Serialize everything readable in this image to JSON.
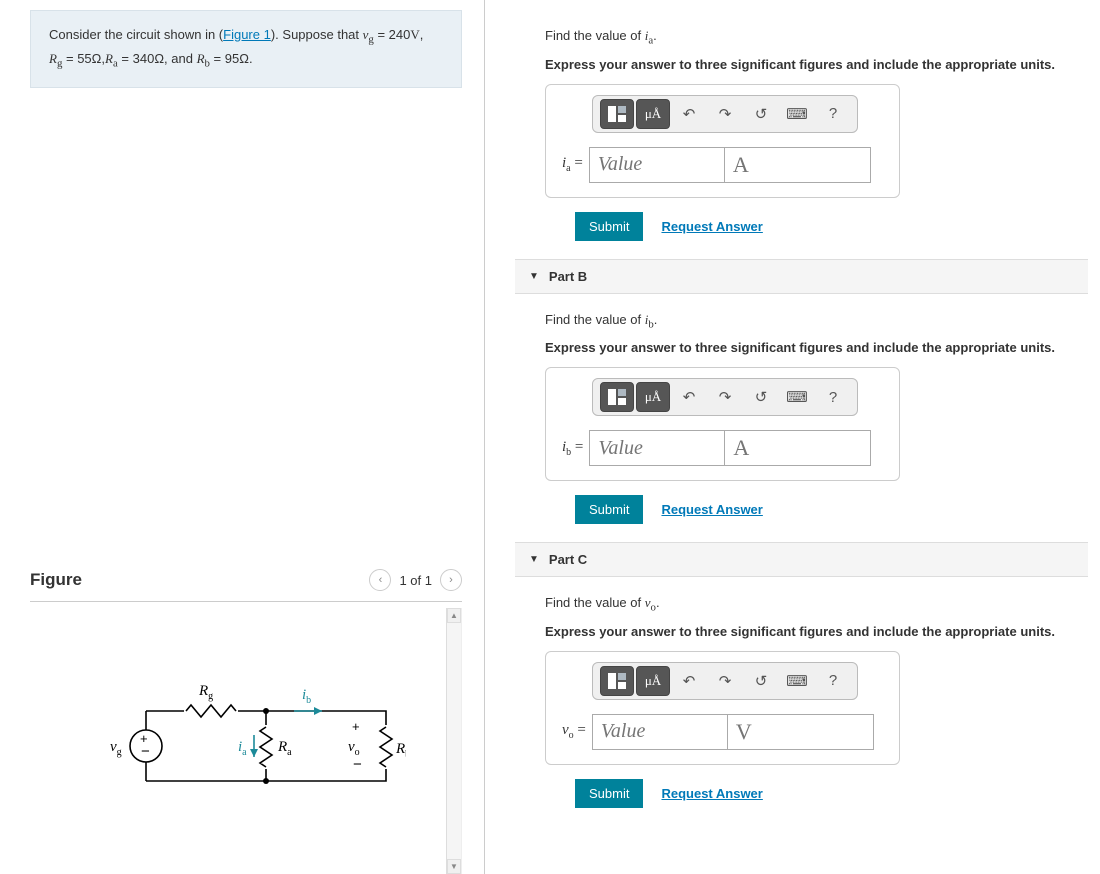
{
  "problem": {
    "pre": "Consider the circuit shown in (",
    "figlink": "Figure 1",
    "post": "). Suppose that ",
    "vg_val": "240",
    "rg_val": "55",
    "ra_val": "340",
    "rb_val": "95"
  },
  "figure": {
    "title": "Figure",
    "pager": "1 of 1",
    "labels": {
      "rg": "R",
      "ib": "i",
      "vg": "v",
      "ia": "i",
      "ra": "R",
      "vo": "v",
      "rb": "R"
    },
    "subs": {
      "rg": "g",
      "ib": "b",
      "vg": "g",
      "ia": "a",
      "ra": "a",
      "vo": "o",
      "rb": "b"
    }
  },
  "toolbar": {
    "templates_tip": "Templates",
    "units_label": "μÅ",
    "undo_tip": "Undo",
    "redo_tip": "Redo",
    "reset_tip": "Reset",
    "keyboard_tip": "Keyboard shortcuts",
    "help": "?"
  },
  "common": {
    "value_ph": "Value",
    "submit": "Submit",
    "request": "Request Answer"
  },
  "parts": {
    "a": {
      "prompt_pre": "Find the value of ",
      "var": "i",
      "sub": "a",
      "prompt_post": ".",
      "instr": "Express your answer to three significant figures and include the appropriate units.",
      "ans_var": "i",
      "ans_sub": "a",
      "eq": "=",
      "unit_ph": "A"
    },
    "b": {
      "header": "Part B",
      "prompt_pre": "Find the value of ",
      "var": "i",
      "sub": "b",
      "prompt_post": ".",
      "instr": "Express your answer to three significant figures and include the appropriate units.",
      "ans_var": "i",
      "ans_sub": "b",
      "eq": "=",
      "unit_ph": "A"
    },
    "c": {
      "header": "Part C",
      "prompt_pre": "Find the value of ",
      "var": "v",
      "sub": "o",
      "prompt_post": ".",
      "instr": "Express your answer to three significant figures and include the appropriate units.",
      "ans_var": "v",
      "ans_sub": "o",
      "eq": "=",
      "unit_ph": "V"
    }
  }
}
